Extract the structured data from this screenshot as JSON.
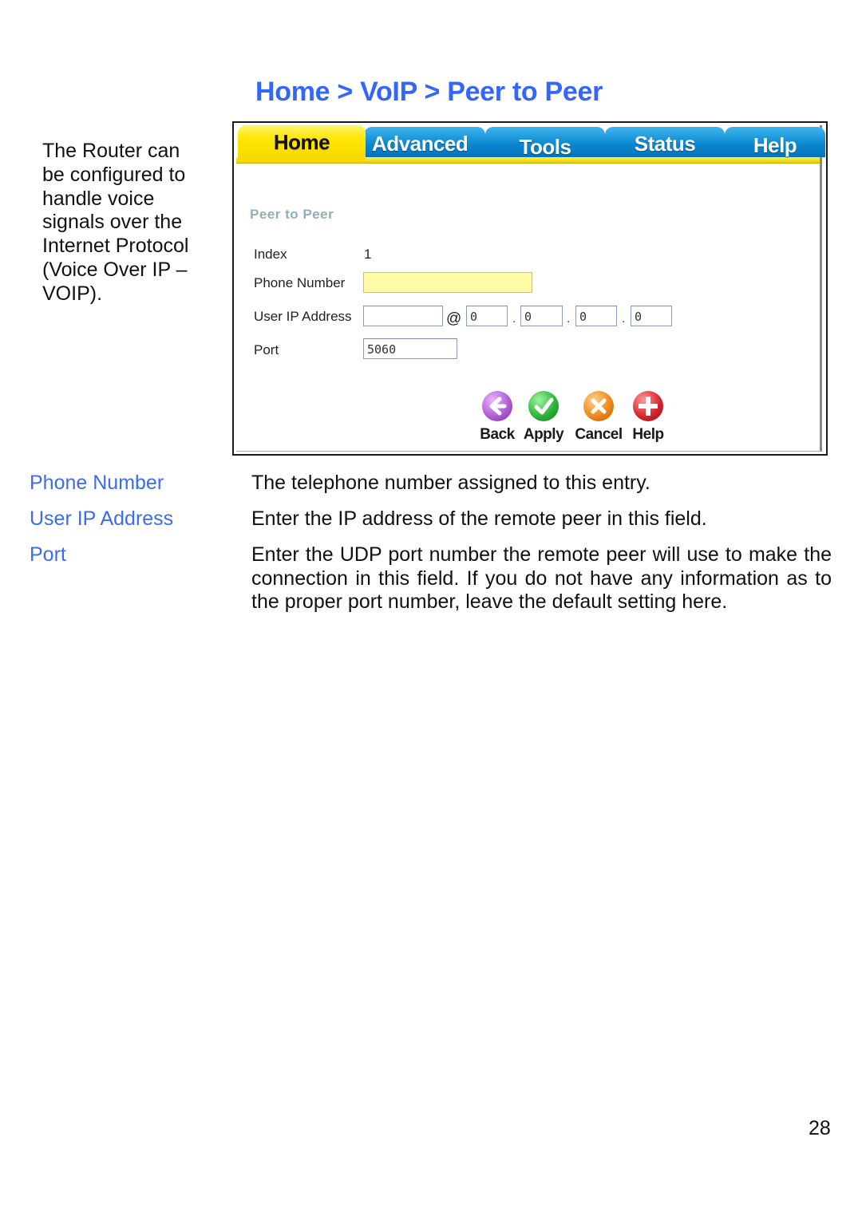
{
  "breadcrumb": "Home > VoIP > Peer to Peer",
  "intro_lines": [
    "The Router can",
    "be configured to",
    "handle voice",
    "signals over the",
    "Internet Protocol",
    "(Voice Over IP –",
    "VOIP)."
  ],
  "router_ui": {
    "tabs": [
      {
        "label": "Home",
        "active": true
      },
      {
        "label": "Advanced",
        "active": false
      },
      {
        "label": "Tools",
        "active": false
      },
      {
        "label": "Status",
        "active": false
      },
      {
        "label": "Help",
        "active": false
      }
    ],
    "panel_title": "Peer to Peer",
    "fields": {
      "index_label": "Index",
      "index_value": "1",
      "phone_label": "Phone Number",
      "phone_value": "",
      "user_ip_label": "User IP Address",
      "user_value": "",
      "at_symbol": "@",
      "ip_octets": [
        "0",
        "0",
        "0",
        "0"
      ],
      "ip_separator": ".",
      "port_label": "Port",
      "port_value": "5060"
    },
    "actions": [
      {
        "label": "Back",
        "icon": "back-arrow-icon",
        "color": "#b25ed6"
      },
      {
        "label": "Apply",
        "icon": "checkmark-icon",
        "color": "#2fb53a"
      },
      {
        "label": "Cancel",
        "icon": "x-cross-icon",
        "color": "#f08a1c"
      },
      {
        "label": "Help",
        "icon": "plus-cross-icon",
        "color": "#d8262e"
      }
    ]
  },
  "definitions": [
    {
      "term": "Phone Number",
      "description": "The telephone number assigned to this entry."
    },
    {
      "term": "User IP Address",
      "description": "Enter the IP address of the remote peer in this field."
    },
    {
      "term": "Port",
      "description": "Enter the UDP port number the remote peer will use to make the connection in this field. If you do not have any information as to the proper port number, leave the default setting here."
    }
  ],
  "page_number": "28",
  "colors": {
    "heading_blue": "#3366ff",
    "term_blue": "#3a6cf0",
    "tab_yellow": "#ffe600",
    "tab_blue": "#0a86cf"
  }
}
